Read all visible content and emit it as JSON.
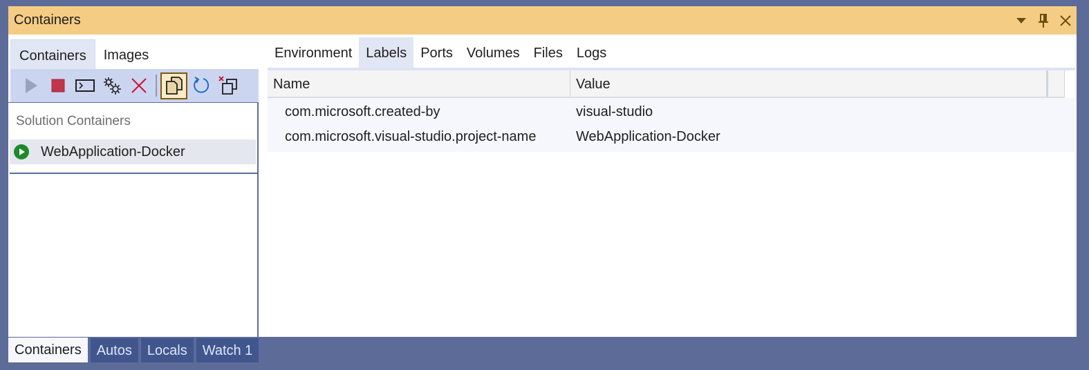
{
  "window": {
    "title": "Containers",
    "controls": {
      "dropdown": "dropdown-arrow-icon",
      "pin": "pin-icon",
      "close": "close-icon"
    }
  },
  "left_pane": {
    "tabs": [
      {
        "label": "Containers",
        "active": true
      },
      {
        "label": "Images",
        "active": false
      }
    ],
    "toolbar": [
      {
        "name": "start-icon",
        "tooltip": "Start",
        "enabled": false
      },
      {
        "name": "stop-icon",
        "tooltip": "Stop"
      },
      {
        "name": "terminal-icon",
        "tooltip": "Open Terminal"
      },
      {
        "name": "settings-icon",
        "tooltip": "Settings"
      },
      {
        "name": "remove-icon",
        "tooltip": "Remove"
      },
      {
        "name": "copy-files-icon",
        "tooltip": "Copy",
        "checked": true
      },
      {
        "name": "refresh-icon",
        "tooltip": "Refresh"
      },
      {
        "name": "prune-icon",
        "tooltip": "Prune"
      }
    ],
    "tree": {
      "group_label": "Solution Containers",
      "items": [
        {
          "label": "WebApplication-Docker",
          "status": "running"
        }
      ]
    }
  },
  "right_pane": {
    "tabs": [
      {
        "label": "Environment",
        "active": false
      },
      {
        "label": "Labels",
        "active": true
      },
      {
        "label": "Ports",
        "active": false
      },
      {
        "label": "Volumes",
        "active": false
      },
      {
        "label": "Files",
        "active": false
      },
      {
        "label": "Logs",
        "active": false
      }
    ],
    "grid": {
      "columns": [
        "Name",
        "Value"
      ],
      "rows": [
        {
          "name": "com.microsoft.created-by",
          "value": "visual-studio"
        },
        {
          "name": "com.microsoft.visual-studio.project-name",
          "value": "WebApplication-Docker"
        }
      ]
    }
  },
  "bottom_tabs": [
    {
      "label": "Containers",
      "active": true
    },
    {
      "label": "Autos",
      "active": false
    },
    {
      "label": "Locals",
      "active": false
    },
    {
      "label": "Watch 1",
      "active": false
    }
  ],
  "colors": {
    "title_bar": "#f5cc84",
    "frame": "#5d6b99",
    "toolbar": "#ccd5f0",
    "running_status": "#1e8a2a",
    "stop": "#c0354a",
    "remove": "#c8102e",
    "refresh": "#1e6fc8"
  }
}
